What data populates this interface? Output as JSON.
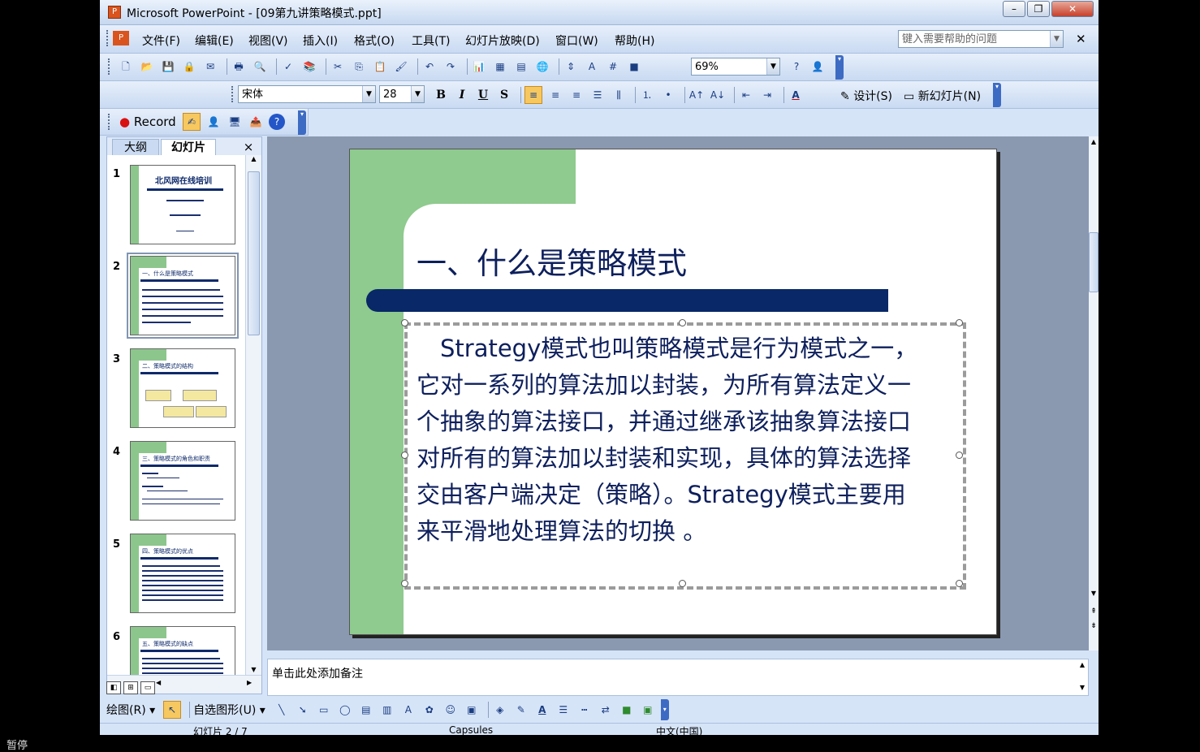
{
  "window": {
    "title": "Microsoft PowerPoint - [09第九讲策略模式.ppt]",
    "controls": [
      "minimize-icon",
      "restore-icon",
      "close-icon"
    ]
  },
  "menu": {
    "items": [
      "文件(F)",
      "编辑(E)",
      "视图(V)",
      "插入(I)",
      "格式(O)",
      "工具(T)",
      "幻灯片放映(D)",
      "窗口(W)",
      "帮助(H)"
    ],
    "help_placeholder": "键入需要帮助的问题"
  },
  "standard_toolbar": {
    "zoom": "69%"
  },
  "format_toolbar": {
    "font": "宋体",
    "size": "28",
    "bold": "B",
    "italic": "I",
    "underline": "U",
    "shadow": "S",
    "design_label": "设计(S)",
    "new_slide_label": "新幻灯片(N)"
  },
  "record_toolbar": {
    "record_label": "Record"
  },
  "left_pane": {
    "tabs": [
      "大纲",
      "幻灯片"
    ],
    "close": "×",
    "thumbnails": [
      {
        "num": "1",
        "title": "北风网在线培训"
      },
      {
        "num": "2",
        "title": "一、什么是策略模式"
      },
      {
        "num": "3",
        "title": "二、策略模式的结构"
      },
      {
        "num": "4",
        "title": "三、策略模式的角色和职责"
      },
      {
        "num": "5",
        "title": "四、策略模式的优点"
      },
      {
        "num": "6",
        "title": "五、策略模式的缺点"
      }
    ]
  },
  "slide": {
    "title": "一、什么是策略模式",
    "body": [
      "　Strategy模式也叫策略模式是行为模式之一，",
      "它对一系列的算法加以封装，为所有算法定义一",
      "个抽象的算法接口，并通过继承该抽象算法接口",
      "对所有的算法加以封装和实现，具体的算法选择",
      "交由客户端决定（策略）。Strategy模式主要用",
      "来平滑地处理算法的切换 。"
    ]
  },
  "notes": {
    "placeholder": "单击此处添加备注"
  },
  "drawing_toolbar": {
    "draw_label": "绘图(R)",
    "autoshapes_label": "自选图形(U)"
  },
  "status_bar": {
    "slide_pos": "幻灯片 2 / 7",
    "design": "Capsules",
    "language": "中文(中国)"
  },
  "overlay": {
    "paused": "暂停"
  }
}
